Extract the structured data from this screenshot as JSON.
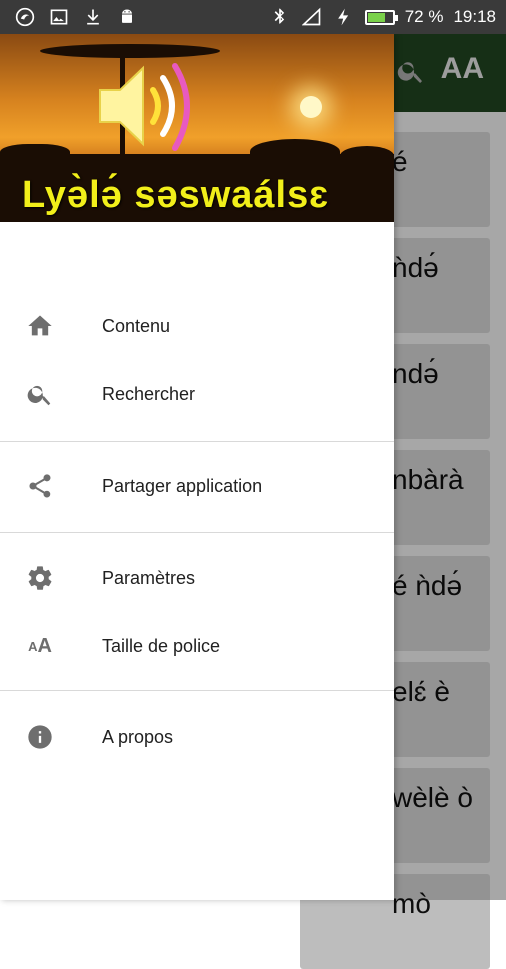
{
  "status_bar": {
    "battery_percent": "72 %",
    "time": "19:18",
    "battery_level": 0.72,
    "left_icons": [
      "app-logo-icon",
      "image-icon",
      "download-icon",
      "android-icon"
    ],
    "right_icons": [
      "bluetooth-icon",
      "signal-icon",
      "charging-icon",
      "battery-icon"
    ]
  },
  "drawer": {
    "header_title": "Lyə̀lə́ səswaálsɛ",
    "menu": [
      {
        "label": "Contenu",
        "icon": "home-icon"
      },
      {
        "label": "Rechercher",
        "icon": "search-icon"
      },
      {
        "label": "Partager application",
        "icon": "share-icon"
      },
      {
        "label": "Paramètres",
        "icon": "settings-icon"
      },
      {
        "label": "Taille de police",
        "icon": "font-size-icon"
      },
      {
        "label": "A propos",
        "icon": "info-icon"
      }
    ]
  },
  "background": {
    "toolbar_font_label": "AA",
    "cards": [
      "é",
      "ǹdə́",
      "ndə́",
      "nbàrà",
      "é ǹdə́",
      "elɛ́ è",
      "wèlè ò",
      "mò"
    ]
  },
  "colors": {
    "toolbar": "#1d3d1d",
    "title_yellow": "#f2ef1a",
    "icon_grey": "#6e6e6e"
  }
}
